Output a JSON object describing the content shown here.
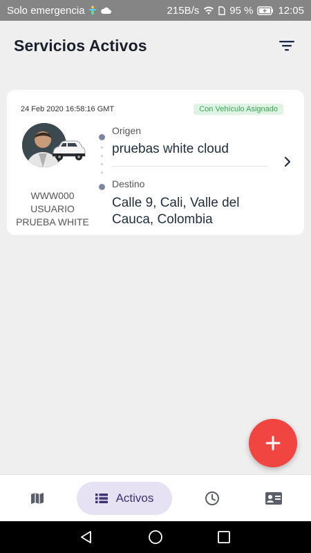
{
  "status_bar": {
    "carrier": "Solo emergencia",
    "speed": "215B/s",
    "battery": "95 %",
    "time": "12:05"
  },
  "header": {
    "title": "Servicios Activos",
    "filter_icon": "filter-icon"
  },
  "service_card": {
    "date": "24 Feb 2020 16:58:16 GMT",
    "status": "Con Vehículo Asignado",
    "plate": "WWW000",
    "driver_name": "USUARIO PRUEBA WHITE",
    "origin_label": "Origen",
    "origin_value": "pruebas white cloud",
    "destination_label": "Destino",
    "destination_value": "Calle 9, Cali, Valle del Cauca, Colombia"
  },
  "fab": {
    "icon": "plus-icon"
  },
  "bottom_nav": {
    "items": [
      {
        "icon": "map-icon"
      },
      {
        "icon": "list-icon",
        "label": "Activos",
        "active": true
      },
      {
        "icon": "clock-icon"
      },
      {
        "icon": "contact-card-icon"
      }
    ]
  },
  "colors": {
    "accent": "#f04540",
    "active_nav_bg": "#e6e2f3",
    "badge_bg": "#dff3e4",
    "badge_text": "#3aa655"
  }
}
